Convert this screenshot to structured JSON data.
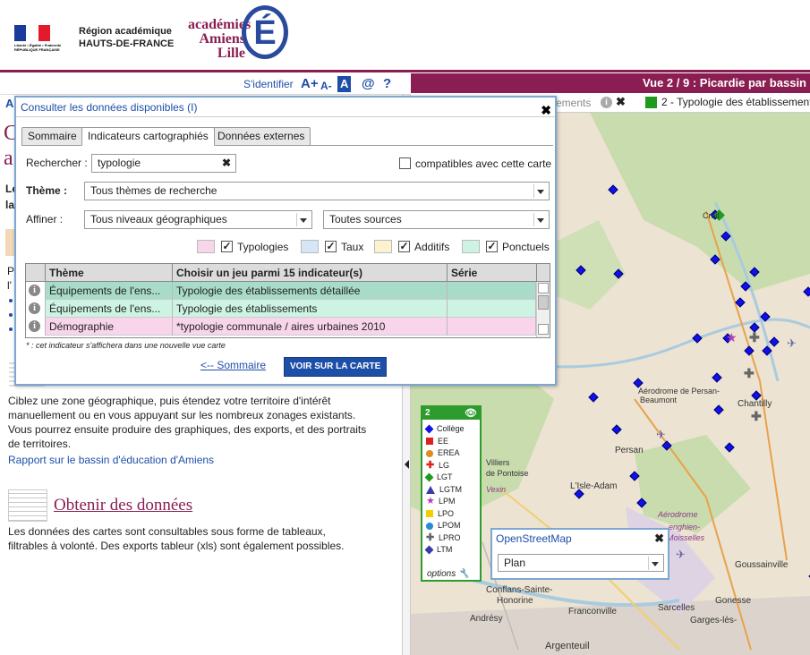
{
  "header": {
    "republic_text": "Liberté • Égalité • Fraternité RÉPUBLIQUE FRANÇAISE",
    "region_line1": "Région académique",
    "region_line2": "HAUTS-DE-FRANCE",
    "academies_line1": "académies",
    "academies_line2": "Amiens",
    "academies_line3": "Lille",
    "academies_e": "É"
  },
  "toolbar": {
    "sidentifier": "S'identifier",
    "a_plus": "A+",
    "a_minus": "A-",
    "a_box": "A",
    "at": "@",
    "help": "?"
  },
  "map_header": {
    "title": "Vue 2 / 9 : Picardie par bassin",
    "layer_name": "2 - Typologie des établissements",
    "layer_prefix": "ements",
    "layer_color": "#1f9a1f"
  },
  "left": {
    "partial_letter_a": "A",
    "partial_c": "C",
    "partial_a": "a",
    "partial_le": "Le",
    "partial_la": "la",
    "partial_p": "P",
    "partial_l": "l'",
    "cibler_text_1": "Ciblez une zone géographique, puis étendez votre territoire d'intérêt",
    "cibler_text_2": "manuellement ou en vous appuyant sur les nombreux zonages existants.",
    "cibler_text_3": "Vous pourrez ensuite produire des graphiques, des exports, et des portraits",
    "cibler_text_4": "de territoires.",
    "rapport_link": "Rapport sur le bassin d'éducation d'Amiens",
    "obtenir_title": "Obtenir des données",
    "obtenir_text_1": "Les données des cartes sont consultables sous forme de tableaux,",
    "obtenir_text_2": "filtrables à volonté. Des exports tableur (xls) sont également possibles."
  },
  "dialog": {
    "title": "Consulter les données disponibles (I)",
    "tabs": [
      "Sommaire",
      "Indicateurs cartographiés",
      "Données externes"
    ],
    "search_label": "Rechercher :",
    "search_value": "typologie",
    "compat_label": "compatibles avec cette carte",
    "theme_label": "Thème :",
    "theme_value": "Tous thèmes de recherche",
    "affiner_label": "Affiner :",
    "niveaux_value": "Tous niveaux géographiques",
    "sources_value": "Toutes sources",
    "filters": [
      {
        "label": "Typologies",
        "color": "#f9d5ec"
      },
      {
        "label": "Taux",
        "color": "#d6e6f6"
      },
      {
        "label": "Additifs",
        "color": "#fbf2cf"
      },
      {
        "label": "Ponctuels",
        "color": "#cdf3e3"
      }
    ],
    "table": {
      "headers": [
        "Thème",
        "Choisir un jeu parmi 15 indicateur(s)",
        "Série"
      ],
      "rows": [
        {
          "theme": "Équipements de l'ens...",
          "indicator": "Typologie des établissements détaillée",
          "serie": "",
          "color": "#a8dcc8"
        },
        {
          "theme": "Équipements de l'ens...",
          "indicator": "Typologie des établissements",
          "serie": "",
          "color": "#cdf3e3"
        },
        {
          "theme": "Démographie",
          "indicator": "*typologie communale / aires urbaines 2010",
          "serie": "",
          "color": "#f9d5ec"
        }
      ]
    },
    "footnote": "* : cet indicateur s'affichera dans une nouvelle vue carte",
    "sommaire_link": "<-- Sommaire",
    "voir_button": "VOIR SUR LA CARTE"
  },
  "legend": {
    "number": "2",
    "items": [
      {
        "label": "Collège",
        "color": "#1010e8",
        "shape": "diamond"
      },
      {
        "label": "EE",
        "color": "#e02020",
        "shape": "square"
      },
      {
        "label": "EREA",
        "color": "#e08a20",
        "shape": "circle"
      },
      {
        "label": "LG",
        "color": "#e02020",
        "shape": "cross"
      },
      {
        "label": "LGT",
        "color": "#1f9a1f",
        "shape": "diamond"
      },
      {
        "label": "LGTM",
        "color": "#3a3aa8",
        "shape": "triangle"
      },
      {
        "label": "LPM",
        "color": "#b040b0",
        "shape": "star"
      },
      {
        "label": "LPO",
        "color": "#f0d000",
        "shape": "square"
      },
      {
        "label": "LPOM",
        "color": "#2a8ad0",
        "shape": "circle"
      },
      {
        "label": "LPRO",
        "color": "#666666",
        "shape": "cross"
      },
      {
        "label": "LTM",
        "color": "#3a3aa8",
        "shape": "diamond"
      }
    ],
    "options": "options"
  },
  "osm": {
    "title": "OpenStreetMap",
    "select_value": "Plan"
  },
  "map_labels": {
    "chantilly": "Chantilly",
    "persan": "Persan",
    "aerodrome1": "Aérodrome de Persan-",
    "aerodrome2": "Beaumont",
    "lisle": "L'Isle-Adam",
    "aerodrome3": "Aérodrome",
    "aerodrome4": "enghien-",
    "aerodrome5": "Moisselles",
    "goussainville": "Goussainville",
    "conflans": "Conflans-Sainte-",
    "honorine": "Honorine",
    "franconville": "Franconville",
    "sarcelles": "Sarcelles",
    "garges": "Garges-lès-",
    "gonesse": "Gonesse",
    "andresy": "Andrésy",
    "argenteuil": "Argenteuil",
    "creil": "Creil",
    "villiers": "Villiers",
    "pontoise": "de Pontoise",
    "vexin": "Vexin"
  }
}
